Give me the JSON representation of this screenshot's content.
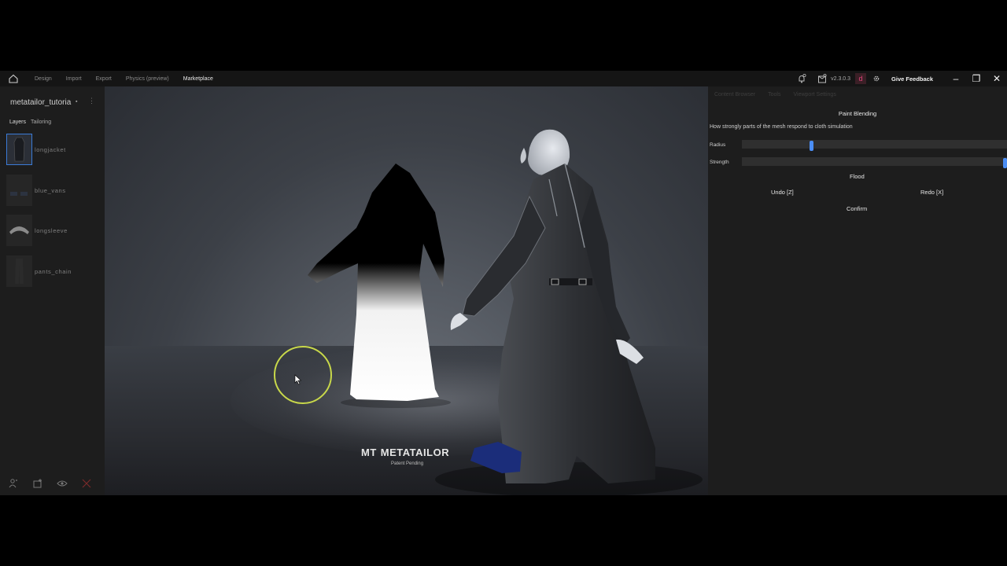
{
  "topbar": {
    "menu": [
      "Design",
      "Import",
      "Export",
      "Physics (preview)",
      "Marketplace"
    ],
    "active_menu": "Marketplace",
    "version": "v2.3.0.3",
    "avatar_letter": "d",
    "feedback_label": "Give Feedback",
    "window_controls": {
      "minimize": "–",
      "restore": "❐",
      "close": "✕"
    }
  },
  "left_panel": {
    "project_name": "metatailor_tutoria",
    "tabs": [
      "Layers",
      "Tailoring"
    ],
    "layers": [
      {
        "name": "longjacket",
        "selected": true
      },
      {
        "name": "blue_vans",
        "selected": false
      },
      {
        "name": "longsleeve",
        "selected": false
      },
      {
        "name": "pants_chain",
        "selected": false
      }
    ]
  },
  "viewport": {
    "logo": "METATAILOR",
    "logo_mark": "MT",
    "patent": "Patent Pending"
  },
  "right_panel": {
    "tabs": [
      "Content Browser",
      "Tools",
      "Viewport Settings"
    ],
    "title": "Paint Blending",
    "description": "How strongly parts of the mesh respond to cloth simulation",
    "sliders": [
      {
        "label": "Radius",
        "value": 0.26
      },
      {
        "label": "Strength",
        "value": 1.0
      }
    ],
    "flood_label": "Flood",
    "undo_label": "Undo [Z]",
    "redo_label": "Redo [X]",
    "confirm_label": "Confirm",
    "accent_color": "#4b8ef5"
  }
}
